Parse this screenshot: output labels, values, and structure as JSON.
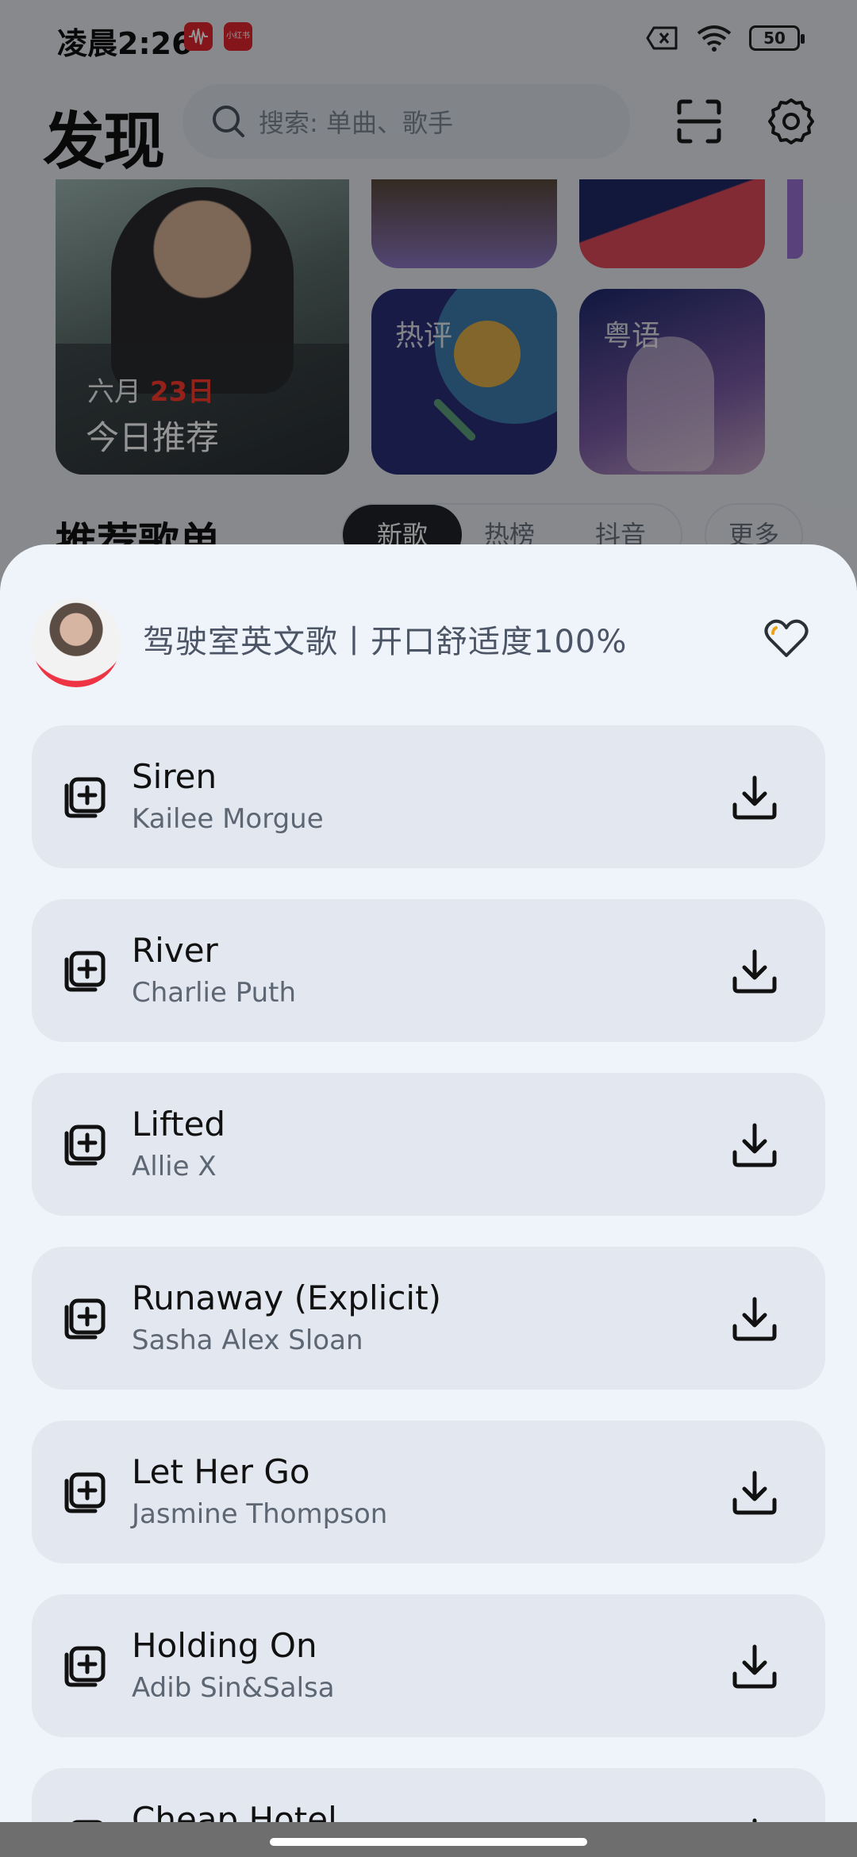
{
  "status_bar": {
    "time": "凌晨2:26",
    "app_icon_2": "小红书",
    "battery": "50"
  },
  "header": {
    "title": "发现",
    "search_placeholder": "搜索: 单曲、歌手"
  },
  "daily": {
    "month": "六月",
    "day": "23日",
    "label": "今日推荐"
  },
  "tiles": [
    {
      "label": "热评"
    },
    {
      "label": "粤语"
    }
  ],
  "section": {
    "title": "推荐歌单",
    "pills": [
      "新歌",
      "热榜",
      "抖音"
    ],
    "active_pill": "新歌",
    "more": "更多"
  },
  "sheet": {
    "playlist_title": "驾驶室英文歌丨开口舒适度100%",
    "songs": [
      {
        "title": "Siren",
        "artist": "Kailee Morgue"
      },
      {
        "title": "River",
        "artist": "Charlie Puth"
      },
      {
        "title": "Lifted",
        "artist": "Allie X"
      },
      {
        "title": "Runaway (Explicit)",
        "artist": "Sasha Alex Sloan"
      },
      {
        "title": "Let Her Go",
        "artist": "Jasmine Thompson"
      },
      {
        "title": "Holding On",
        "artist": "Adib Sin&Salsa"
      },
      {
        "title": "Cheap Hotel",
        "artist": ""
      }
    ]
  },
  "icons": {
    "search": "search-icon",
    "scan": "scan-icon",
    "settings": "gear-icon",
    "add": "add-to-playlist-icon",
    "download": "download-icon",
    "favorite": "heart-icon"
  },
  "colors": {
    "accent_red": "#ff3b30",
    "sheet_bg": "#eff4fb",
    "item_bg": "#e3e8f0"
  }
}
